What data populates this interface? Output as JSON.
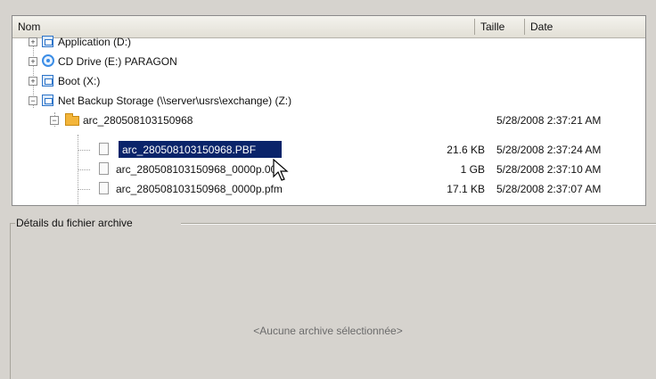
{
  "columns": {
    "name": "Nom",
    "size": "Taille",
    "date": "Date"
  },
  "tree": [
    {
      "label": "Application (D:)",
      "icon": "drive-icon"
    },
    {
      "label": "CD Drive (E:) PARAGON",
      "icon": "cd-drive-icon"
    },
    {
      "label": "Boot (X:)",
      "icon": "drive-icon"
    },
    {
      "label": "Net Backup Storage (\\\\server\\usrs\\exchange) (Z:)",
      "icon": "network-drive-icon"
    },
    {
      "label": "arc_280508103150968",
      "icon": "folder-icon",
      "size": "",
      "date": "5/28/2008 2:37:21 AM"
    },
    {
      "label": "arc_280508103150968.PBF",
      "icon": "file-icon",
      "size": "21.6 KB",
      "date": "5/28/2008 2:37:24 AM",
      "selected": true
    },
    {
      "label": "arc_280508103150968_0000p.000",
      "icon": "file-icon",
      "size": "1 GB",
      "date": "5/28/2008 2:37:10 AM"
    },
    {
      "label": "arc_280508103150968_0000p.pfm",
      "icon": "file-icon",
      "size": "17.1 KB",
      "date": "5/28/2008 2:37:07 AM"
    }
  ],
  "details": {
    "title": "Détails du fichier archive",
    "empty_message": "<Aucune archive sélectionnée>"
  },
  "colors": {
    "selection": "#0a246a",
    "panel": "#d6d3ce"
  }
}
